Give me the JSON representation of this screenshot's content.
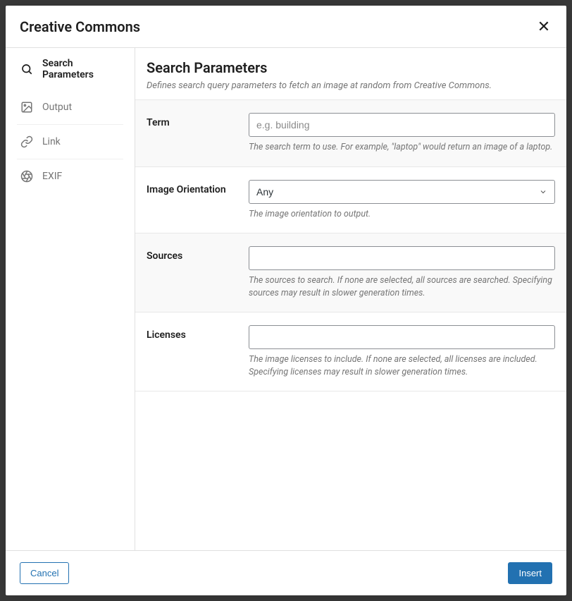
{
  "modal": {
    "title": "Creative Commons"
  },
  "sidebar": {
    "items": [
      {
        "label": "Search Parameters"
      },
      {
        "label": "Output"
      },
      {
        "label": "Link"
      },
      {
        "label": "EXIF"
      }
    ]
  },
  "content": {
    "title": "Search Parameters",
    "description": "Defines search query parameters to fetch an image at random from Creative Commons."
  },
  "fields": {
    "term": {
      "label": "Term",
      "placeholder": "e.g. building",
      "help": "The search term to use. For example, \"laptop\" would return an image of a laptop."
    },
    "orientation": {
      "label": "Image Orientation",
      "value": "Any",
      "help": "The image orientation to output."
    },
    "sources": {
      "label": "Sources",
      "help": "The sources to search. If none are selected, all sources are searched. Specifying sources may result in slower generation times."
    },
    "licenses": {
      "label": "Licenses",
      "help": "The image licenses to include. If none are selected, all licenses are included. Specifying licenses may result in slower generation times."
    }
  },
  "footer": {
    "cancel": "Cancel",
    "insert": "Insert"
  }
}
